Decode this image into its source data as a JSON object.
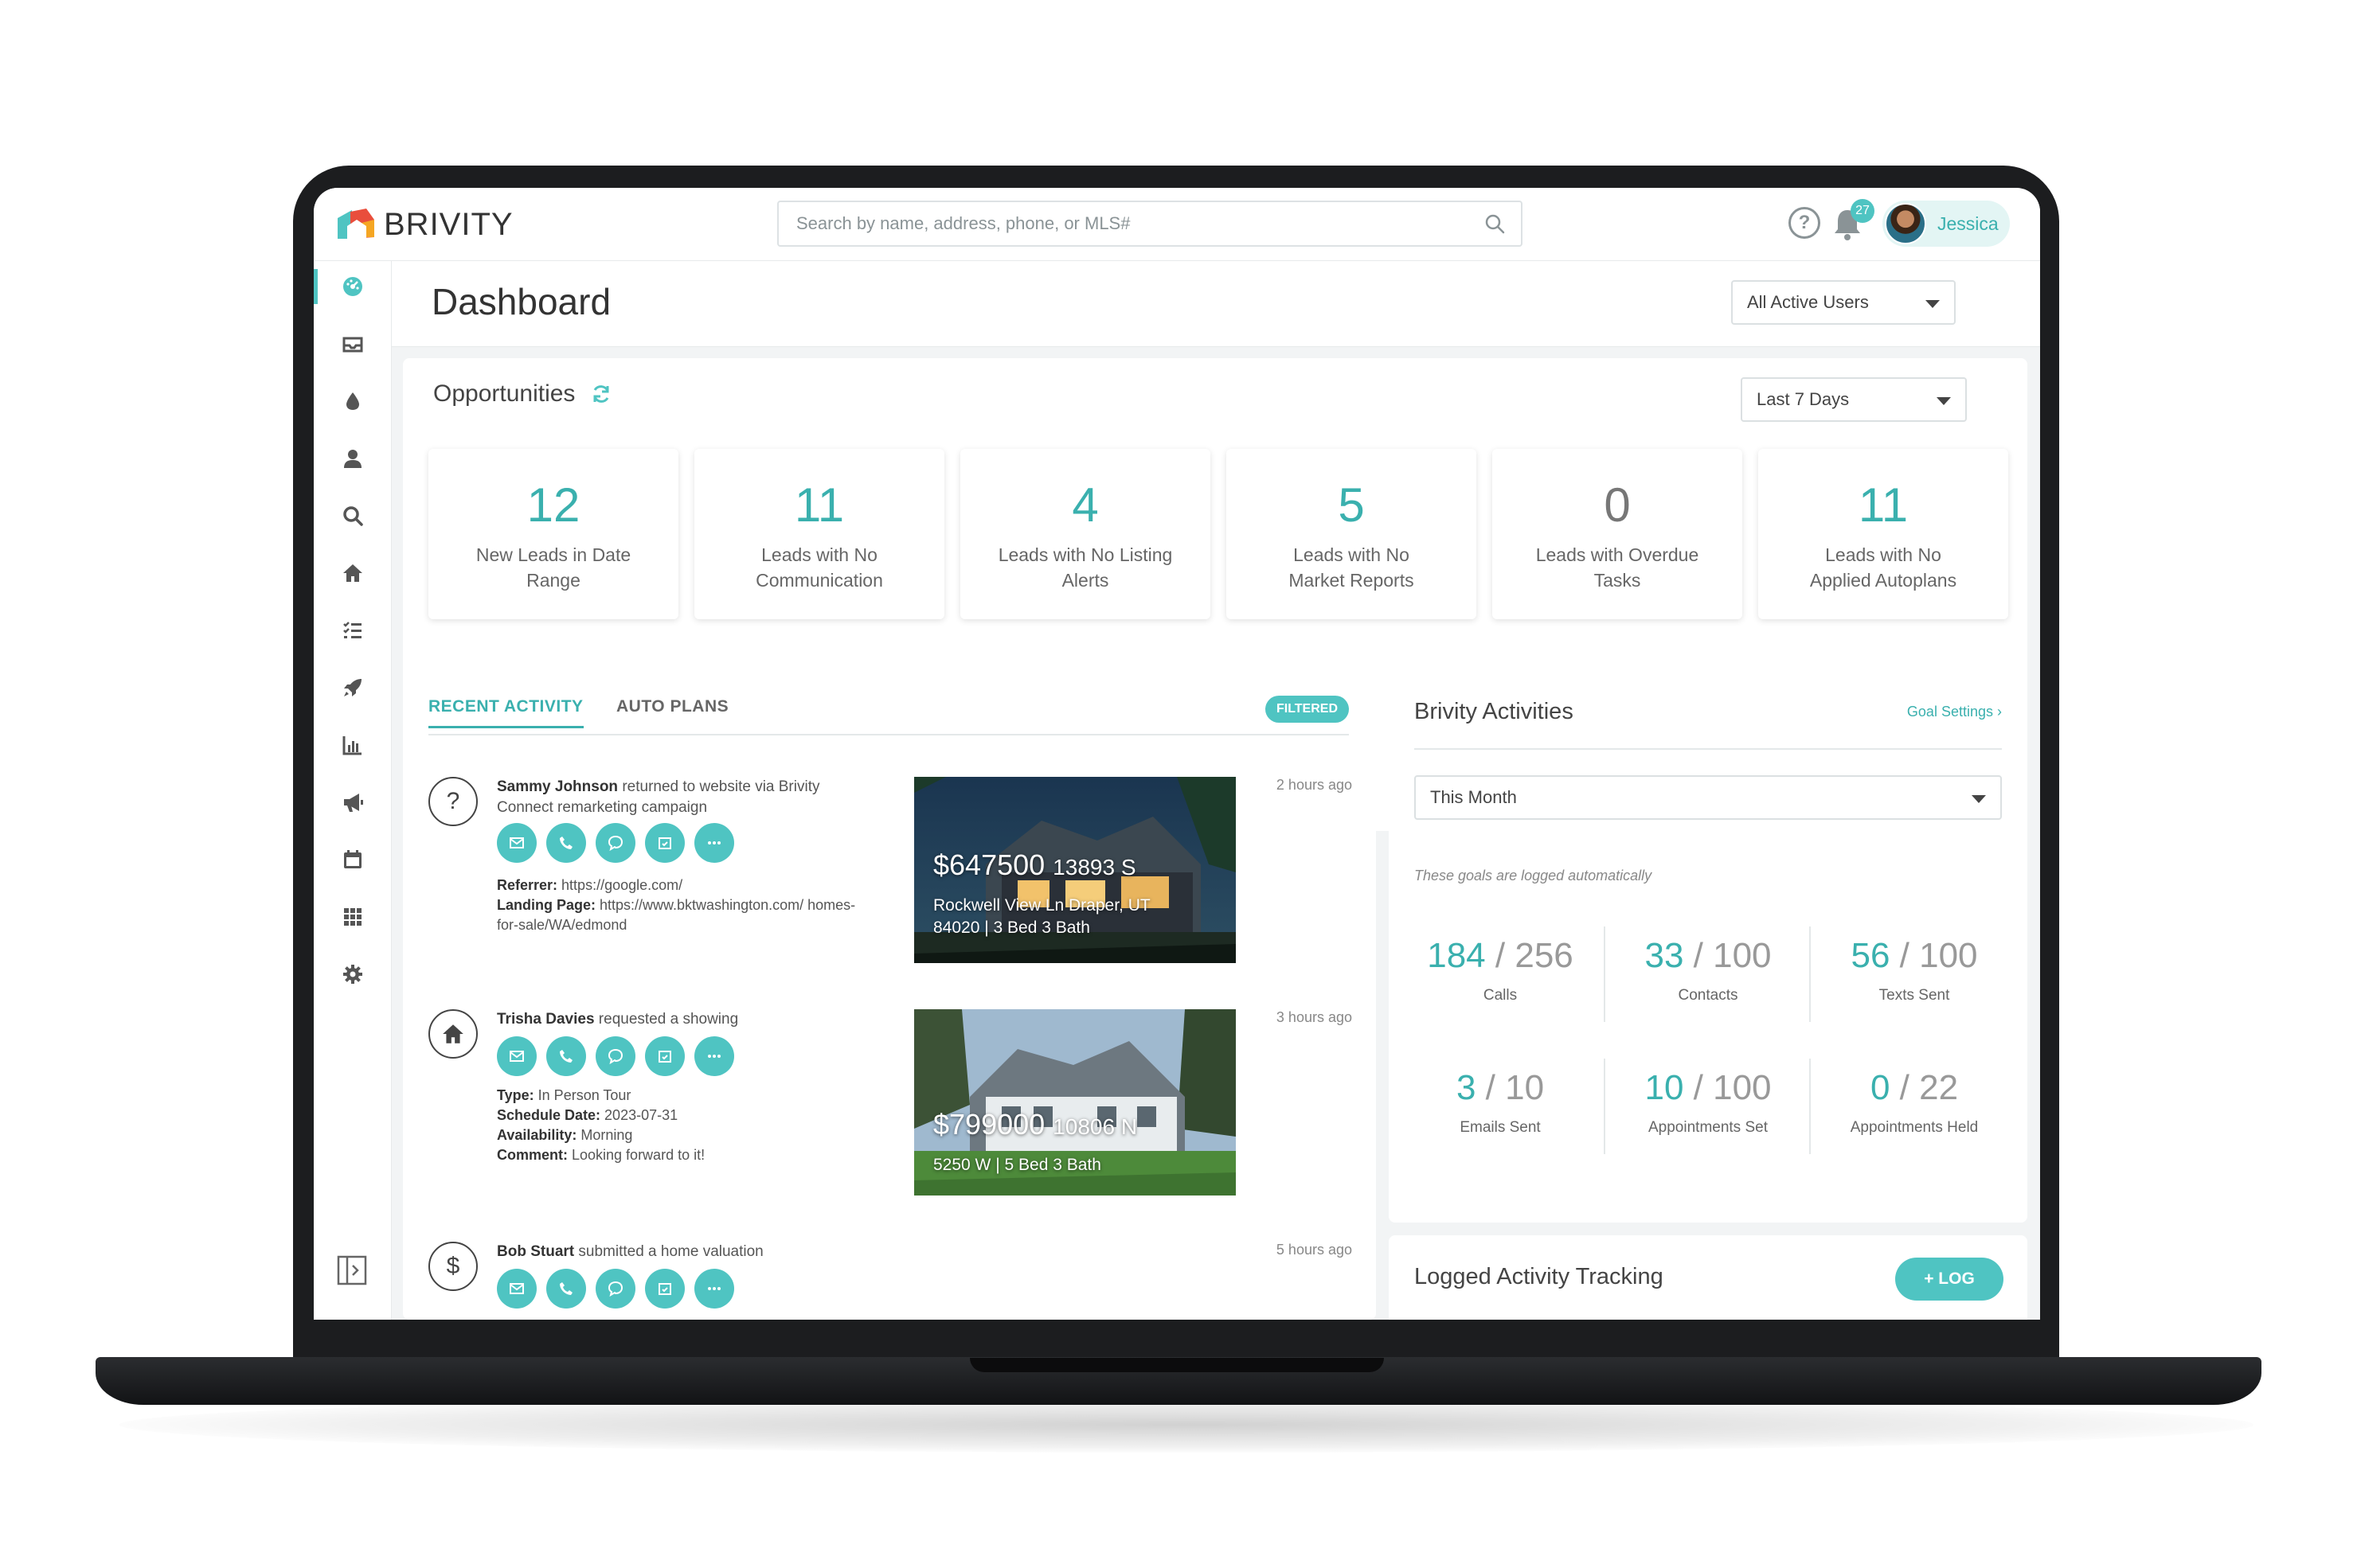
{
  "app": {
    "brand": "BRIVITY"
  },
  "search": {
    "placeholder": "Search by name, address, phone, or MLS#",
    "value": ""
  },
  "header": {
    "notification_count": "27",
    "user_name": "Jessica"
  },
  "page": {
    "title": "Dashboard",
    "users_filter": "All Active Users"
  },
  "sidebar": {
    "items": [
      {
        "icon": "dashboard-icon"
      },
      {
        "icon": "inbox-icon"
      },
      {
        "icon": "drop-icon"
      },
      {
        "icon": "person-icon"
      },
      {
        "icon": "search-icon"
      },
      {
        "icon": "home-icon"
      },
      {
        "icon": "tasks-icon"
      },
      {
        "icon": "rocket-icon"
      },
      {
        "icon": "chart-icon"
      },
      {
        "icon": "megaphone-icon"
      },
      {
        "icon": "calendar-icon"
      },
      {
        "icon": "apps-grid-icon"
      },
      {
        "icon": "gear-icon"
      }
    ]
  },
  "opportunities": {
    "title": "Opportunities",
    "range": "Last 7 Days",
    "cards": [
      {
        "value": "12",
        "label": "New Leads in Date Range"
      },
      {
        "value": "11",
        "label": "Leads with No Communication"
      },
      {
        "value": "4",
        "label": "Leads with No Listing Alerts"
      },
      {
        "value": "5",
        "label": "Leads with No Market Reports"
      },
      {
        "value": "0",
        "label": "Leads with Overdue Tasks"
      },
      {
        "value": "11",
        "label": "Leads with No Applied Autoplans"
      }
    ]
  },
  "activity": {
    "tabs": [
      "RECENT ACTIVITY",
      "AUTO PLANS"
    ],
    "filter_badge": "FILTERED",
    "items": [
      {
        "icon_glyph": "?",
        "name": "Sammy Johnson",
        "action": " returned to website via Brivity Connect remarketing campaign",
        "time": "2 hours ago",
        "details": [
          {
            "key": "Referrer:",
            "value": " https://google.com/"
          },
          {
            "key": "Landing Page:",
            "value": " https://www.bktwashington.com/ homes-for-sale/WA/edmond"
          }
        ],
        "listing": {
          "price": "$647500",
          "street_no": "13893 S",
          "address": "Rockwell View Ln Draper, UT 84020 | 3 Bed 3 Bath"
        }
      },
      {
        "icon_glyph": "home",
        "name": "Trisha Davies",
        "action": " requested a showing",
        "time": "3 hours ago",
        "details": [
          {
            "key": "Type:",
            "value": " In Person Tour"
          },
          {
            "key": "Schedule Date:",
            "value": " 2023-07-31"
          },
          {
            "key": "Availability:",
            "value": " Morning"
          },
          {
            "key": "Comment:",
            "value": " Looking forward to it!"
          }
        ],
        "listing": {
          "price": "$799000",
          "street_no": "10806 N",
          "address": "5250 W | 5 Bed 3 Bath"
        }
      },
      {
        "icon_glyph": "$",
        "name": "Bob Stuart",
        "action": " submitted a home valuation",
        "time": "5 hours ago"
      }
    ]
  },
  "brivity_activities": {
    "title": "Brivity Activities",
    "goal_settings": "Goal Settings",
    "period": "This Month",
    "note": "These goals are logged automatically",
    "goals": [
      {
        "done": "184",
        "total": "256",
        "label": "Calls"
      },
      {
        "done": "33",
        "total": "100",
        "label": "Contacts"
      },
      {
        "done": "56",
        "total": "100",
        "label": "Texts Sent"
      },
      {
        "done": "3",
        "total": "10",
        "label": "Emails Sent"
      },
      {
        "done": "10",
        "total": "100",
        "label": "Appointments Set"
      },
      {
        "done": "0",
        "total": "22",
        "label": "Appointments Held"
      }
    ]
  },
  "logged_activity": {
    "title": "Logged Activity Tracking",
    "button": "+ LOG"
  },
  "colors": {
    "accent": "#4fc4c2",
    "accent_text": "#3ab0ae",
    "logo_red": "#e94e3c",
    "logo_orange": "#f5a623"
  }
}
